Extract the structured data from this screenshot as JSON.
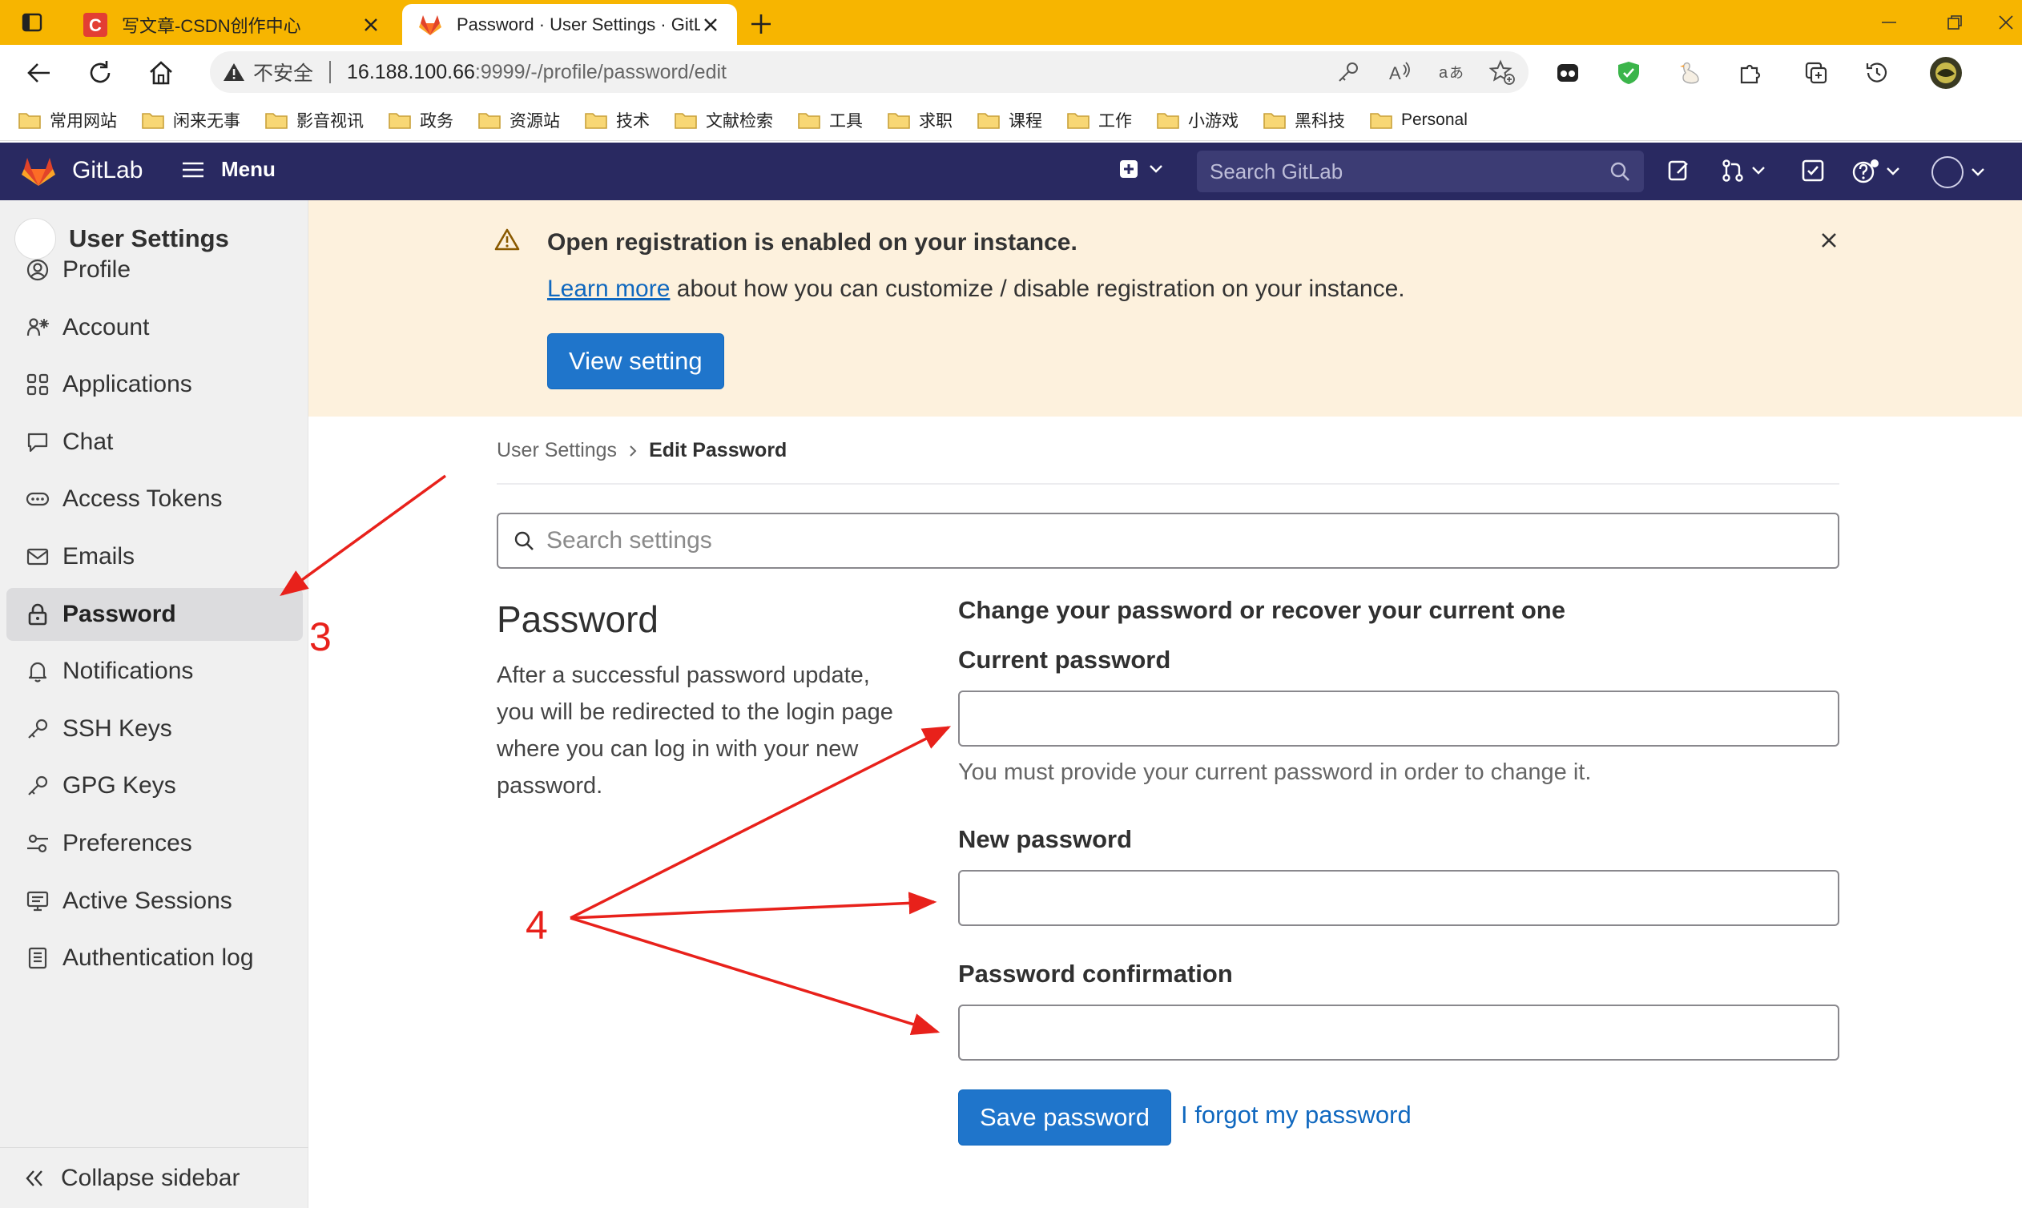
{
  "browser": {
    "tabs": [
      {
        "title": "写文章-CSDN创作中心",
        "favicon": "csdn-icon"
      },
      {
        "title": "Password · User Settings · GitLab",
        "favicon": "gitlab-icon"
      }
    ],
    "address": {
      "security_label": "不安全",
      "url_host": "16.188.100.66",
      "url_path": ":9999/-/profile/password/edit"
    },
    "bookmarks": [
      "常用网站",
      "闲来无事",
      "影音视讯",
      "政务",
      "资源站",
      "技术",
      "文献检索",
      "工具",
      "求职",
      "课程",
      "工作",
      "小游戏",
      "黑科技",
      "Personal"
    ]
  },
  "gitlab_nav": {
    "brand": "GitLab",
    "menu_label": "Menu",
    "search_placeholder": "Search GitLab"
  },
  "sidebar": {
    "title": "User Settings",
    "items": [
      {
        "label": "Profile",
        "icon": "profile-icon"
      },
      {
        "label": "Account",
        "icon": "account-icon"
      },
      {
        "label": "Applications",
        "icon": "applications-icon"
      },
      {
        "label": "Chat",
        "icon": "chat-icon"
      },
      {
        "label": "Access Tokens",
        "icon": "token-icon"
      },
      {
        "label": "Emails",
        "icon": "mail-icon"
      },
      {
        "label": "Password",
        "icon": "lock-icon"
      },
      {
        "label": "Notifications",
        "icon": "bell-icon"
      },
      {
        "label": "SSH Keys",
        "icon": "key-icon"
      },
      {
        "label": "GPG Keys",
        "icon": "key-icon"
      },
      {
        "label": "Preferences",
        "icon": "preferences-icon"
      },
      {
        "label": "Active Sessions",
        "icon": "monitor-icon"
      },
      {
        "label": "Authentication log",
        "icon": "log-icon"
      }
    ],
    "active_item": "Password",
    "collapse_label": "Collapse sidebar"
  },
  "banner": {
    "title": "Open registration is enabled on your instance.",
    "link_text": "Learn more",
    "text_rest": " about how you can customize / disable registration on your instance.",
    "button_label": "View setting"
  },
  "breadcrumb": {
    "parent": "User Settings",
    "current": "Edit Password"
  },
  "settings_search": {
    "placeholder": "Search settings",
    "value": ""
  },
  "section": {
    "title": "Password",
    "description": "After a successful password update, you will be redirected to the login page where you can log in with your new password."
  },
  "form": {
    "heading": "Change your password or recover your current one",
    "current_label": "Current password",
    "current_value": "",
    "current_help": "You must provide your current password in order to change it.",
    "new_label": "New password",
    "new_value": "",
    "confirm_label": "Password confirmation",
    "confirm_value": "",
    "save_label": "Save password",
    "forgot_label": "I forgot my password"
  },
  "annotations": {
    "step3": "3",
    "step4": "4",
    "color": "#e8211b"
  },
  "colors": {
    "browser_accent": "#f7b500",
    "gitlab_nav": "#292961",
    "primary_button": "#1f75cb",
    "link": "#1068bf",
    "banner_bg": "#fdf1dd",
    "sidebar_bg": "#f0f0f0"
  }
}
